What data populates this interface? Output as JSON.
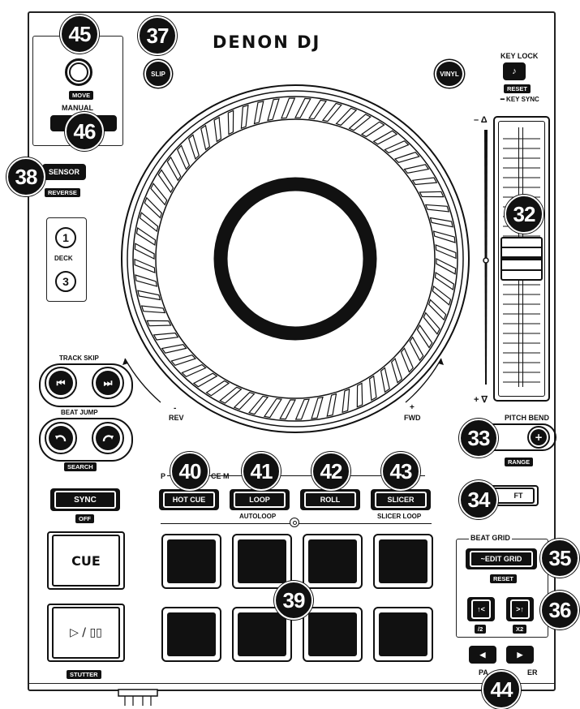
{
  "brand": "DENON DJ",
  "controls": {
    "slip": "SLIP",
    "vinyl": "VINYL",
    "key_lock": "KEY LOCK",
    "key_lock_icon": "♪",
    "key_reset": "RESET",
    "key_sync": "━ KEY SYNC",
    "move": "MOVE",
    "manual": "MANUAL",
    "sensor": "SENSOR",
    "reverse": "REVERSE",
    "deck_label": "DECK",
    "deck_1": "1",
    "deck_3": "3",
    "track_skip": "TRACK SKIP",
    "track_prev_icon": "⏮",
    "track_next_icon": "⏭",
    "beat_jump": "BEAT JUMP",
    "search": "SEARCH",
    "sync": "SYNC",
    "sync_off": "OFF",
    "cue": "CUE",
    "play_pause": "▷ / ▯▯",
    "stutter": "STUTTER",
    "rev": "REV",
    "fwd": "FWD",
    "rev_sign": "-",
    "fwd_sign": "+",
    "pitch_top": "– Δ",
    "pitch_bottom": "+ ∇",
    "pitch_bend": "PITCH BEND",
    "pitch_bend_minus": "−",
    "pitch_bend_plus": "+",
    "range": "RANGE",
    "shift_fragment": "FT",
    "perf_mode_left": "P",
    "perf_mode_mid": "CE M",
    "hot_cue": "HOT CUE",
    "loop": "LOOP",
    "roll": "ROLL",
    "slicer": "SLICER",
    "autoloop": "AUTOLOOP",
    "slicer_loop": "SLICER LOOP",
    "beat_grid": "BEAT GRID",
    "edit_grid": "~EDIT GRID",
    "beat_grid_reset": "RESET",
    "grid_left_icon": "↑<",
    "grid_right_icon": ">↑",
    "half": "/2",
    "x2": "X2",
    "param_left": "◀",
    "param_right": "▶",
    "param_label_left": "PA",
    "param_label_right": "ER"
  },
  "callouts": {
    "c32": "32",
    "c33": "33",
    "c34": "34",
    "c35": "35",
    "c36": "36",
    "c37": "37",
    "c38": "38",
    "c39": "39",
    "c40": "40",
    "c41": "41",
    "c42": "42",
    "c43": "43",
    "c44": "44",
    "c45": "45",
    "c46": "46"
  }
}
